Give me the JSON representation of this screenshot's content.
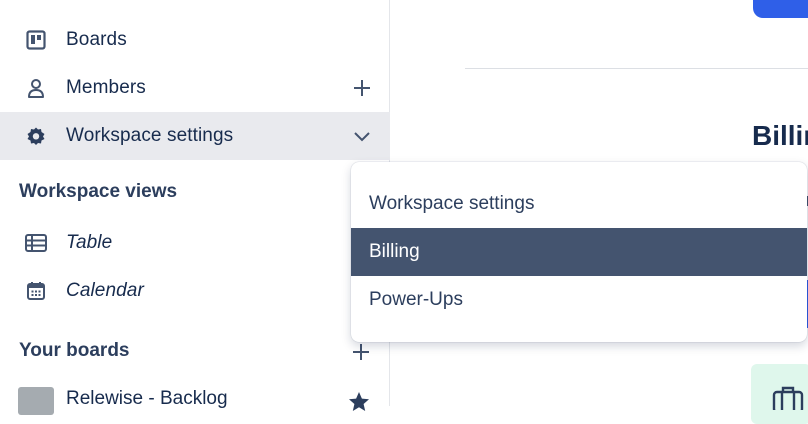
{
  "sidebar": {
    "nav": [
      {
        "label": "Boards",
        "icon": "board-icon"
      },
      {
        "label": "Members",
        "icon": "person-icon",
        "trail": "plus-icon"
      },
      {
        "label": "Workspace settings",
        "icon": "gear-icon",
        "trail": "chevron-down-icon",
        "active": true
      }
    ],
    "views_title": "Workspace views",
    "views": [
      {
        "label": "Table",
        "icon": "table-icon"
      },
      {
        "label": "Calendar",
        "icon": "calendar-icon"
      }
    ],
    "boards_title": "Your boards",
    "boards": [
      {
        "label": "Relewise - Backlog",
        "starred": true
      }
    ]
  },
  "main": {
    "heading": "Billing"
  },
  "dropdown": {
    "items": [
      {
        "label": "Workspace settings"
      },
      {
        "label": "Billing",
        "selected": true
      },
      {
        "label": "Power-Ups"
      }
    ]
  },
  "colors": {
    "active_bg": "#e9eaee",
    "selected_bg": "#44546f",
    "primary_blue": "#2f5fe8",
    "text": "#172b4d"
  }
}
